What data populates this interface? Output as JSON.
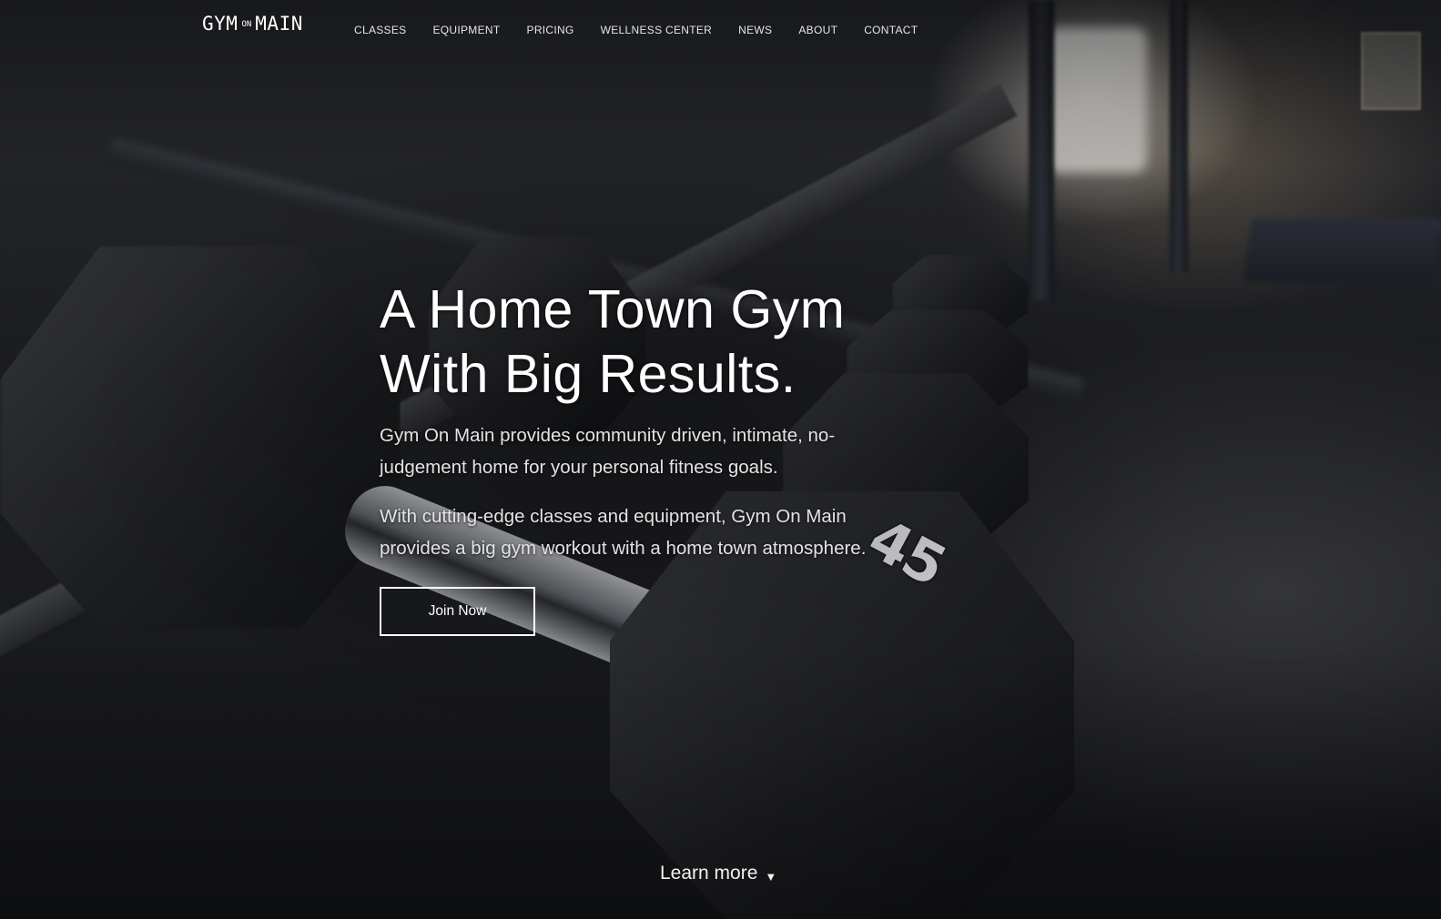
{
  "logo": {
    "part1": "GYM",
    "part2": "ON",
    "part3": "MAIN"
  },
  "nav": {
    "items": [
      {
        "label": "CLASSES",
        "name": "nav-classes"
      },
      {
        "label": "EQUIPMENT",
        "name": "nav-equipment"
      },
      {
        "label": "PRICING",
        "name": "nav-pricing"
      },
      {
        "label": "WELLNESS CENTER",
        "name": "nav-wellness-center"
      },
      {
        "label": "NEWS",
        "name": "nav-news"
      },
      {
        "label": "ABOUT",
        "name": "nav-about"
      },
      {
        "label": "CONTACT",
        "name": "nav-contact"
      }
    ]
  },
  "hero": {
    "headline_line1": "A Home Town Gym",
    "headline_line2": "With Big Results.",
    "paragraph1": "Gym On Main provides community driven, intimate, no-judgement home for your personal fitness goals.",
    "paragraph2": "With cutting-edge classes and equipment, Gym On Main provides a big gym workout with a home town atmosphere.",
    "cta_label": "Join Now",
    "dumbbell_weight_label": "45"
  },
  "learn_more": {
    "label": "Learn more",
    "icon": "triangle-down-icon"
  },
  "colors": {
    "text": "#ffffff",
    "nav_text": "#e6e6e6",
    "background": "#1a1b1e"
  }
}
